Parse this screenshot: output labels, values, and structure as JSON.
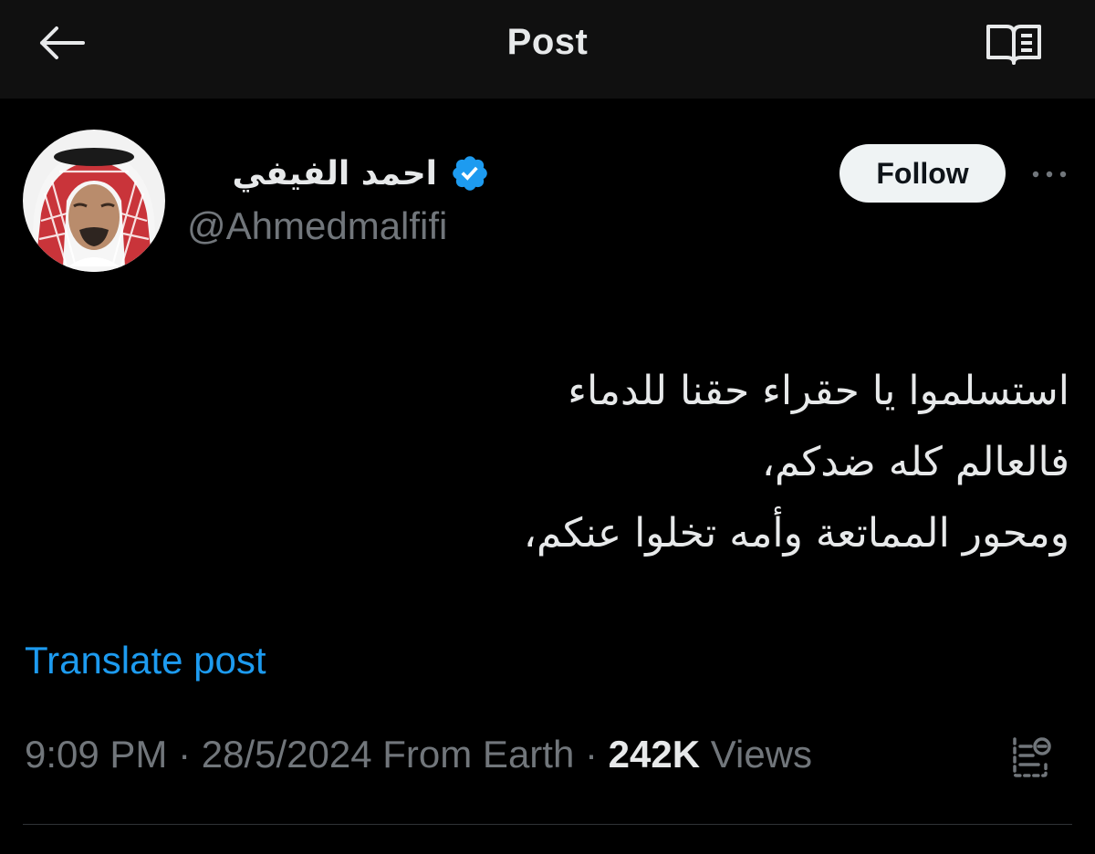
{
  "header": {
    "title": "Post",
    "back_icon": "arrow-left-icon",
    "reader_icon": "open-book-icon"
  },
  "author": {
    "display_name": "احمد الفيفي",
    "handle": "@Ahmedmalfifi",
    "verified": true,
    "verified_color": "#1d9bf0"
  },
  "actions": {
    "follow_label": "Follow",
    "more_icon": "more-horizontal-icon"
  },
  "tweet": {
    "lines": [
      "استسلموا يا حقراء حقنا للدماء",
      "فالعالم كله ضدكم،",
      "ومحور المماتعة وأمه تخلوا عنكم،"
    ]
  },
  "translate_label": "Translate post",
  "meta": {
    "time": "9:09 PM",
    "separator": " · ",
    "date": "28/5/2024",
    "source": "From Earth",
    "views_count": "242K",
    "views_label": "Views",
    "analytics_icon": "analytics-icon"
  },
  "colors": {
    "background": "#000000",
    "header_background": "#101010",
    "link": "#1d9bf0",
    "muted_text": "#71767b",
    "primary_text": "#e7e9ea"
  }
}
